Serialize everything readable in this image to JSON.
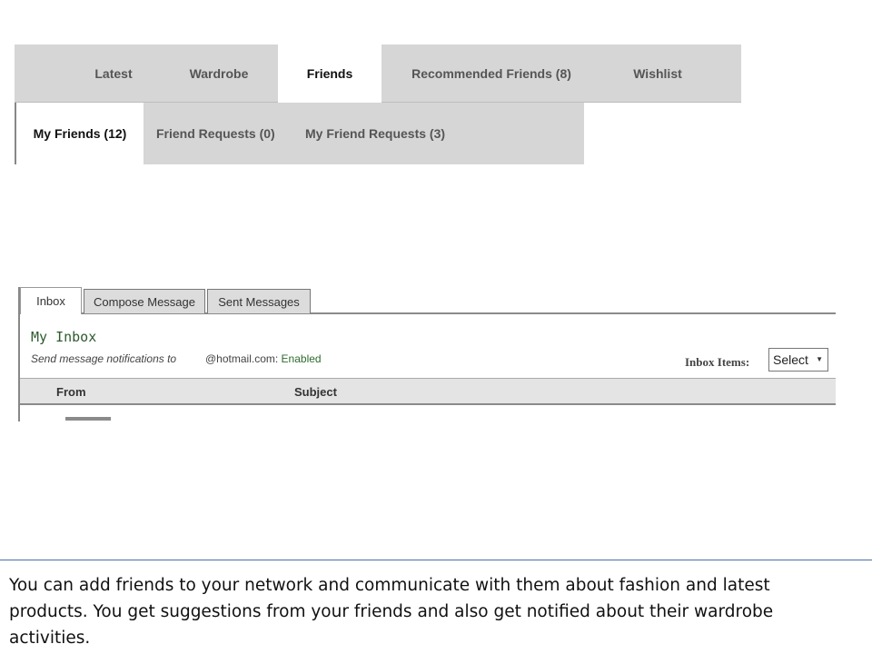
{
  "main_tabs": [
    {
      "label": "Latest",
      "active": false
    },
    {
      "label": "Wardrobe",
      "active": false
    },
    {
      "label": "Friends",
      "active": true
    },
    {
      "label": "Recommended Friends (8)",
      "active": false
    },
    {
      "label": "Wishlist",
      "active": false
    }
  ],
  "sub_tabs": [
    {
      "label": "My Friends (12)",
      "active": true
    },
    {
      "label": "Friend Requests (0)",
      "active": false
    },
    {
      "label": "My Friend Requests (3)",
      "active": false
    }
  ],
  "message_tabs": [
    {
      "label": "Inbox",
      "active": true
    },
    {
      "label": "Compose Message",
      "active": false
    },
    {
      "label": "Sent Messages",
      "active": false
    }
  ],
  "inbox": {
    "title": "My Inbox",
    "notify_prefix": "Send message notifications to",
    "notify_email": "@hotmail.com",
    "notify_status": "Enabled",
    "items_label": "Inbox Items:",
    "select_value": "Select",
    "columns": {
      "from": "From",
      "subject": "Subject"
    }
  },
  "caption": "You can add friends to your network and communicate with them about fashion and latest products.  You get suggestions from your friends and also get notified about their wardrobe activities."
}
